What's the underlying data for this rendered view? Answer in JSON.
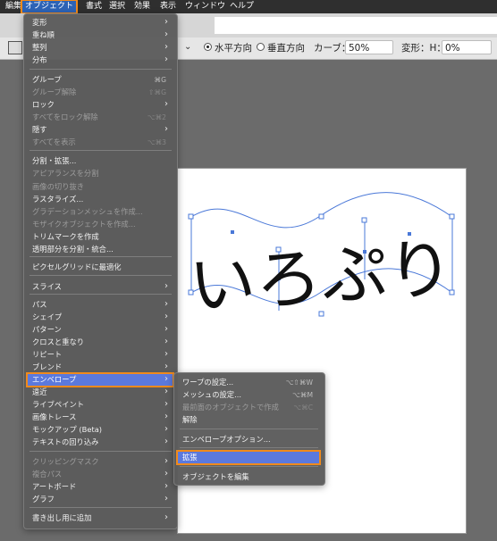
{
  "menubar": {
    "items": [
      "編集",
      "オブジェクト",
      "書式",
      "選択",
      "効果",
      "表示",
      "ウィンドウ",
      "ヘルプ"
    ]
  },
  "toolbar": {
    "horizontal_label": "水平方向",
    "vertical_label": "垂直方向",
    "curve_label": "カーブ：",
    "curve_value": "50%",
    "distort_h_label": "変形：H：",
    "distort_h_value": "0%"
  },
  "object_menu": {
    "items": [
      {
        "label": "変形",
        "submenu": true
      },
      {
        "label": "重ね順",
        "submenu": true
      },
      {
        "label": "整列",
        "submenu": true
      },
      {
        "label": "分布",
        "submenu": true
      },
      {
        "label": "グループ",
        "shortcut": "⌘G"
      },
      {
        "label": "グループ解除",
        "shortcut": "⇧⌘G",
        "disabled": true
      },
      {
        "label": "ロック",
        "submenu": true
      },
      {
        "label": "すべてをロック解除",
        "shortcut": "⌥⌘2",
        "disabled": true
      },
      {
        "label": "隠す",
        "submenu": true
      },
      {
        "label": "すべてを表示",
        "shortcut": "⌥⌘3",
        "disabled": true
      },
      {
        "label": "分割・拡張..."
      },
      {
        "label": "アピアランスを分割",
        "disabled": true
      },
      {
        "label": "画像の切り抜き",
        "disabled": true
      },
      {
        "label": "ラスタライズ..."
      },
      {
        "label": "グラデーションメッシュを作成...",
        "disabled": true
      },
      {
        "label": "モザイクオブジェクトを作成...",
        "disabled": true
      },
      {
        "label": "トリムマークを作成"
      },
      {
        "label": "透明部分を分割・統合..."
      },
      {
        "label": "ピクセルグリッドに最適化"
      },
      {
        "label": "スライス",
        "submenu": true
      },
      {
        "label": "パス",
        "submenu": true
      },
      {
        "label": "シェイプ",
        "submenu": true
      },
      {
        "label": "パターン",
        "submenu": true
      },
      {
        "label": "クロスと重なり",
        "submenu": true
      },
      {
        "label": "リピート",
        "submenu": true
      },
      {
        "label": "ブレンド",
        "submenu": true
      },
      {
        "label": "エンベロープ",
        "submenu": true,
        "highlighted": true
      },
      {
        "label": "遠近",
        "submenu": true
      },
      {
        "label": "ライブペイント",
        "submenu": true
      },
      {
        "label": "画像トレース",
        "submenu": true
      },
      {
        "label": "モックアップ (Beta)",
        "submenu": true
      },
      {
        "label": "テキストの回り込み",
        "submenu": true
      },
      {
        "label": "クリッピングマスク",
        "submenu": true,
        "disabled": true
      },
      {
        "label": "複合パス",
        "submenu": true,
        "disabled": true
      },
      {
        "label": "アートボード",
        "submenu": true
      },
      {
        "label": "グラフ",
        "submenu": true
      },
      {
        "label": "書き出し用に追加",
        "submenu": true
      }
    ]
  },
  "envelope_submenu": {
    "items": [
      {
        "label": "ワープの設定...",
        "shortcut": "⌥⇧⌘W"
      },
      {
        "label": "メッシュの設定...",
        "shortcut": "⌥⌘M"
      },
      {
        "label": "最前面のオブジェクトで作成",
        "shortcut": "⌥⌘C",
        "disabled": true
      },
      {
        "label": "解除"
      },
      {
        "label": "エンベロープオプション..."
      },
      {
        "label": "拡張",
        "highlighted": true
      },
      {
        "label": "オブジェクトを編集"
      }
    ]
  },
  "artwork": {
    "text": "いろぷり"
  },
  "colors": {
    "selection": "#4a78d8",
    "highlight": "#5b79dd",
    "callout": "#f08a1c"
  }
}
